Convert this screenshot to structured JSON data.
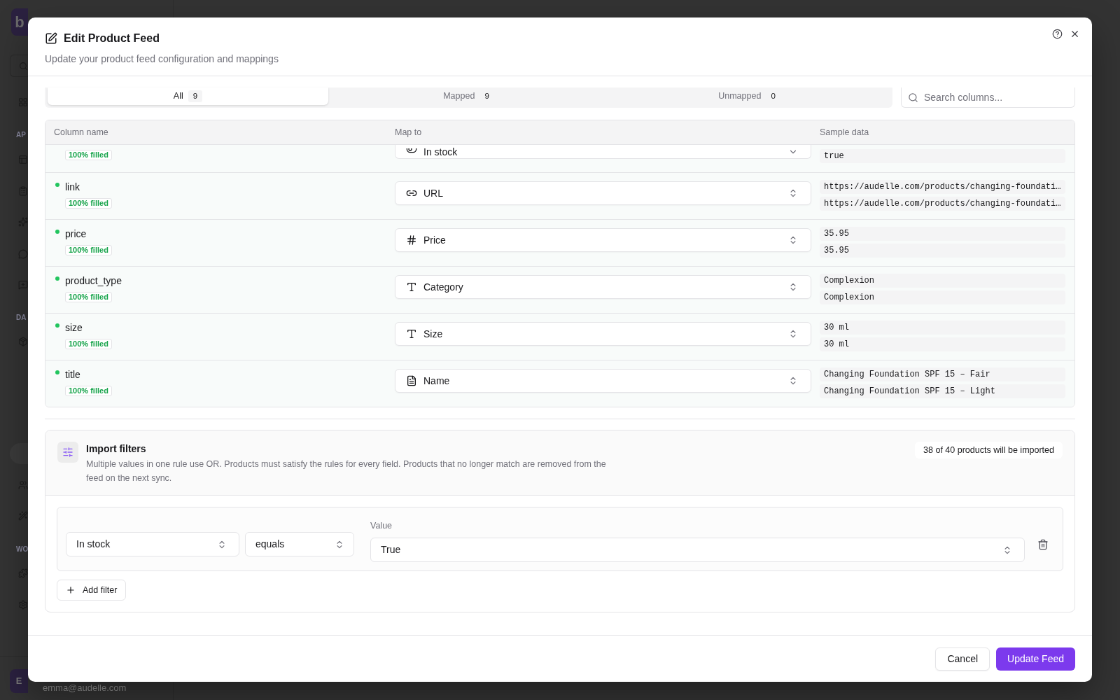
{
  "background": {
    "logo": "b",
    "section_labels": [
      "AP",
      "DA",
      "WO"
    ],
    "user": {
      "initial": "E",
      "email": "emma@audelle.com"
    }
  },
  "dialog": {
    "title": "Edit Product Feed",
    "subtitle": "Update your product feed configuration and mappings"
  },
  "tabs": [
    {
      "label": "All",
      "count": "9",
      "selected": true
    },
    {
      "label": "Mapped",
      "count": "9",
      "selected": false
    },
    {
      "label": "Unmapped",
      "count": "0",
      "selected": false
    }
  ],
  "search": {
    "placeholder": "Search columns..."
  },
  "table": {
    "columns": [
      "Column name",
      "Map to",
      "Sample data"
    ],
    "rows": [
      {
        "kind": "cut",
        "fill": "100% filled",
        "map_to": {
          "label": "In stock",
          "kind": "toggle"
        },
        "samples": [
          "true"
        ]
      },
      {
        "kind": "full",
        "name": "link",
        "mapped": true,
        "fill": "100% filled",
        "map_to": {
          "label": "URL",
          "kind": "link"
        },
        "samples": [
          "https://audelle.com/products/changing-foundati…",
          "https://audelle.com/products/changing-foundati…"
        ]
      },
      {
        "kind": "full",
        "name": "price",
        "mapped": true,
        "fill": "100% filled",
        "map_to": {
          "label": "Price",
          "kind": "number"
        },
        "samples": [
          "35.95",
          "35.95"
        ]
      },
      {
        "kind": "full",
        "name": "product_type",
        "mapped": true,
        "fill": "100% filled",
        "map_to": {
          "label": "Category",
          "kind": "text"
        },
        "samples": [
          "Complexion",
          "Complexion"
        ]
      },
      {
        "kind": "full",
        "name": "size",
        "mapped": true,
        "fill": "100% filled",
        "map_to": {
          "label": "Size",
          "kind": "text"
        },
        "samples": [
          "30 ml",
          "30 ml"
        ]
      },
      {
        "kind": "full",
        "name": "title",
        "mapped": true,
        "fill": "100% filled",
        "map_to": {
          "label": "Name",
          "kind": "document"
        },
        "samples": [
          "Changing Foundation SPF 15 – Fair",
          "Changing Foundation SPF 15 – Light"
        ]
      }
    ]
  },
  "import_filters": {
    "title": "Import filters",
    "description": "Multiple values in one rule use OR. Products must satisfy the rules for every field. Products that no longer match are removed from the feed on the next sync.",
    "summary": "38 of 40 products will be imported",
    "filters": [
      {
        "field": "In stock",
        "operator": "equals",
        "value_label": "Value",
        "value": "True"
      }
    ],
    "add_button": "Add filter"
  },
  "footer": {
    "buttons": [
      {
        "label": "Cancel",
        "kind": "secondary"
      },
      {
        "label": "Update Feed",
        "kind": "primary"
      }
    ]
  }
}
